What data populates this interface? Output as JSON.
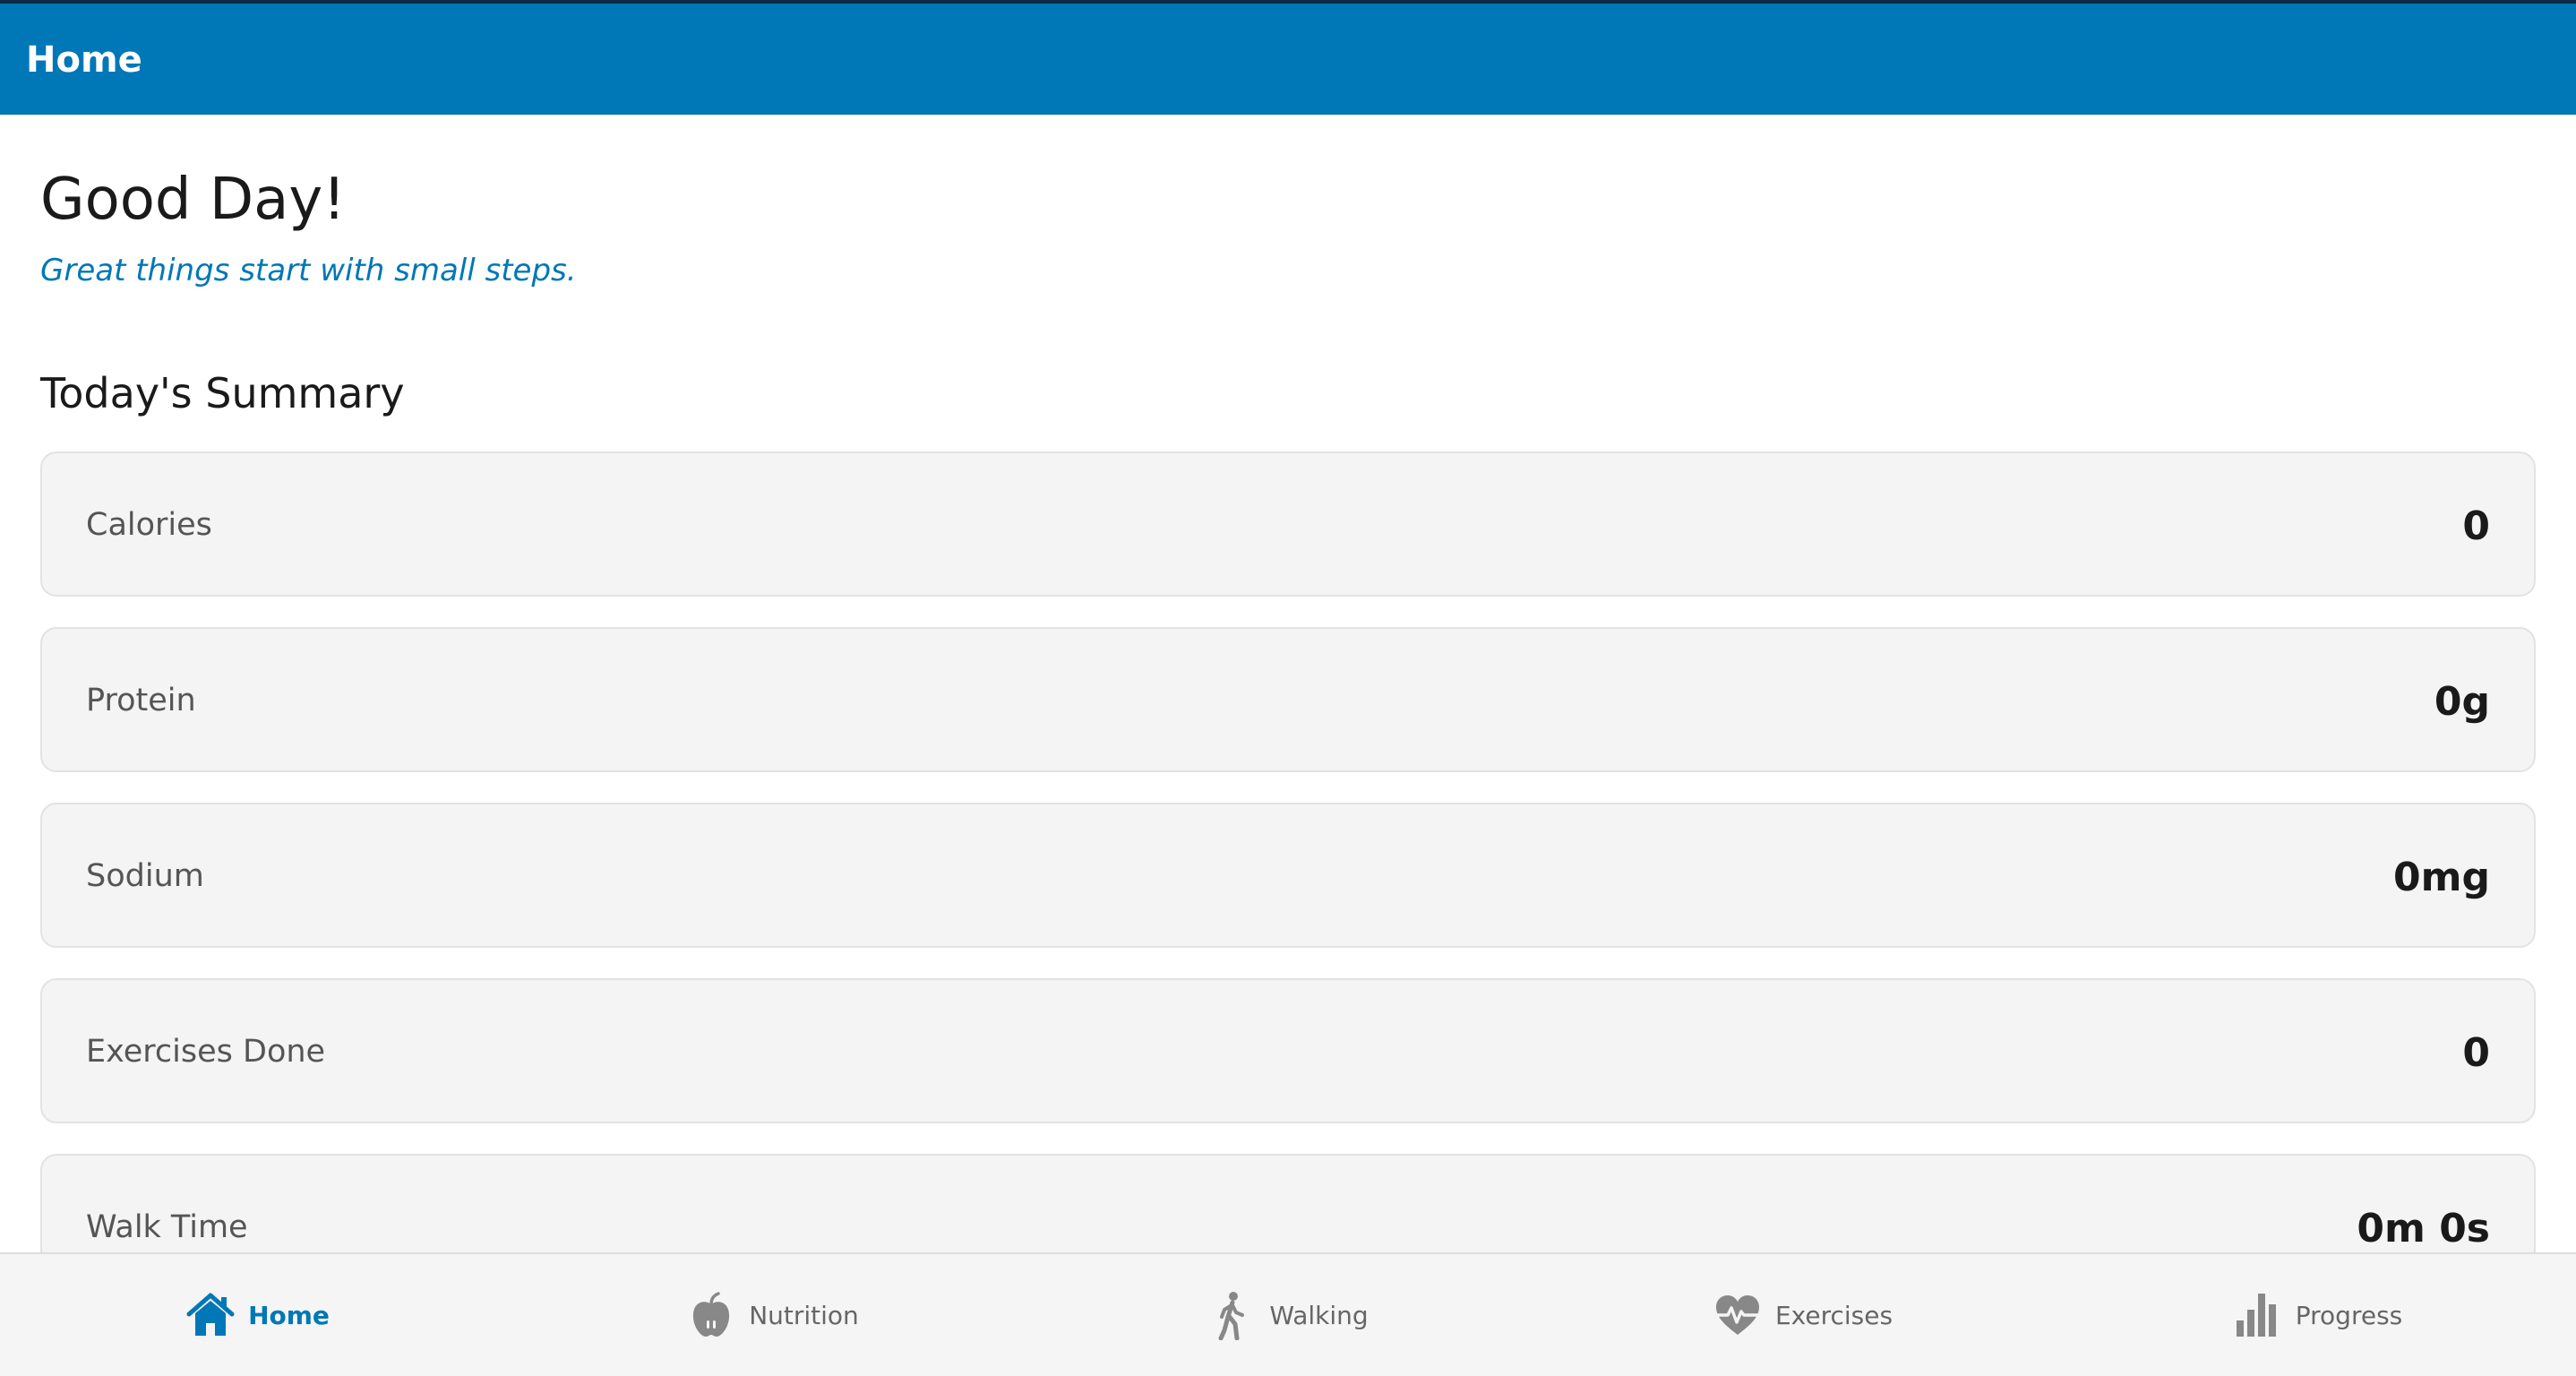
{
  "header": {
    "title": "Home"
  },
  "main": {
    "greeting": "Good Day!",
    "tagline": "Great things start with small steps.",
    "summary_title": "Today's Summary",
    "summary": [
      {
        "label": "Calories",
        "value": "0"
      },
      {
        "label": "Protein",
        "value": "0g"
      },
      {
        "label": "Sodium",
        "value": "0mg"
      },
      {
        "label": "Exercises Done",
        "value": "0"
      },
      {
        "label": "Walk Time",
        "value": "0m 0s"
      }
    ]
  },
  "nav": {
    "items": [
      {
        "label": "Home",
        "icon": "home-icon",
        "active": true
      },
      {
        "label": "Nutrition",
        "icon": "apple-icon",
        "active": false
      },
      {
        "label": "Walking",
        "icon": "walking-person-icon",
        "active": false
      },
      {
        "label": "Exercises",
        "icon": "heartbeat-icon",
        "active": false
      },
      {
        "label": "Progress",
        "icon": "bar-chart-icon",
        "active": false
      }
    ]
  },
  "colors": {
    "primary": "#0077b6",
    "header_border": "#0d2b45",
    "card_bg": "#f4f4f4",
    "inactive_nav": "#666666"
  }
}
